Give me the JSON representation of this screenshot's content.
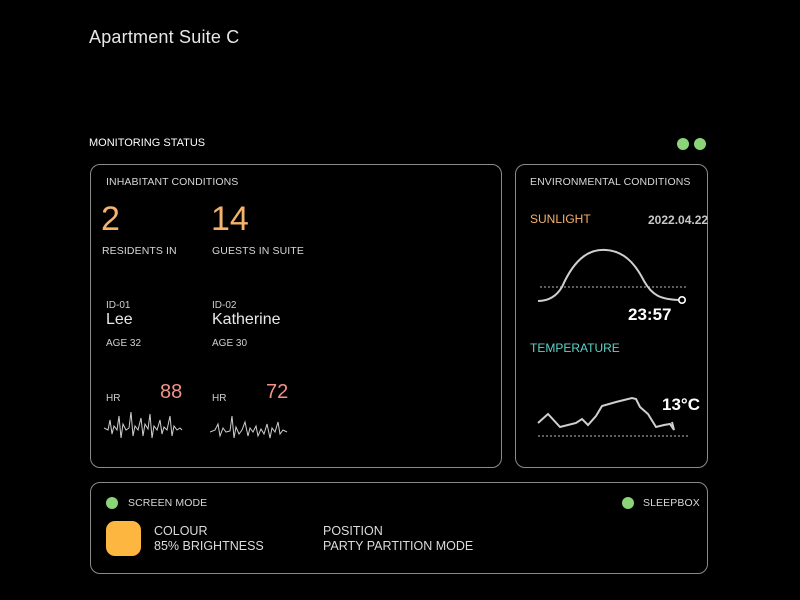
{
  "header": {
    "title": "Apartment Suite C"
  },
  "monitoring": {
    "label": "MONITORING STATUS",
    "status_color": "#8bd47a"
  },
  "inhabitant": {
    "title": "INHABITANT CONDITIONS",
    "residents_count": "2",
    "residents_label": "RESIDENTS IN",
    "guests_count": "14",
    "guests_label": "GUESTS IN SUITE",
    "people": [
      {
        "id": "ID-01",
        "name": "Lee",
        "age": "AGE 32",
        "hr_label": "HR",
        "hr_value": "88"
      },
      {
        "id": "ID-02",
        "name": "Katherine",
        "age": "AGE 30",
        "hr_label": "HR",
        "hr_value": "72"
      }
    ]
  },
  "environment": {
    "title": "ENVIRONMENTAL CONDITIONS",
    "sunlight_label": "SUNLIGHT",
    "date": "2022.04.22",
    "time": "23:57",
    "temperature_label": "TEMPERATURE",
    "temperature_value": "13°C"
  },
  "bottom": {
    "screen_mode_label": "SCREEN MODE",
    "sleepbox_label": "SLEEPBOX",
    "colour_label": "COLOUR",
    "brightness": "85% BRIGHTNESS",
    "position_label": "POSITION",
    "position_value": "PARTY PARTITION MODE",
    "swatch_color": "#fdb640"
  }
}
